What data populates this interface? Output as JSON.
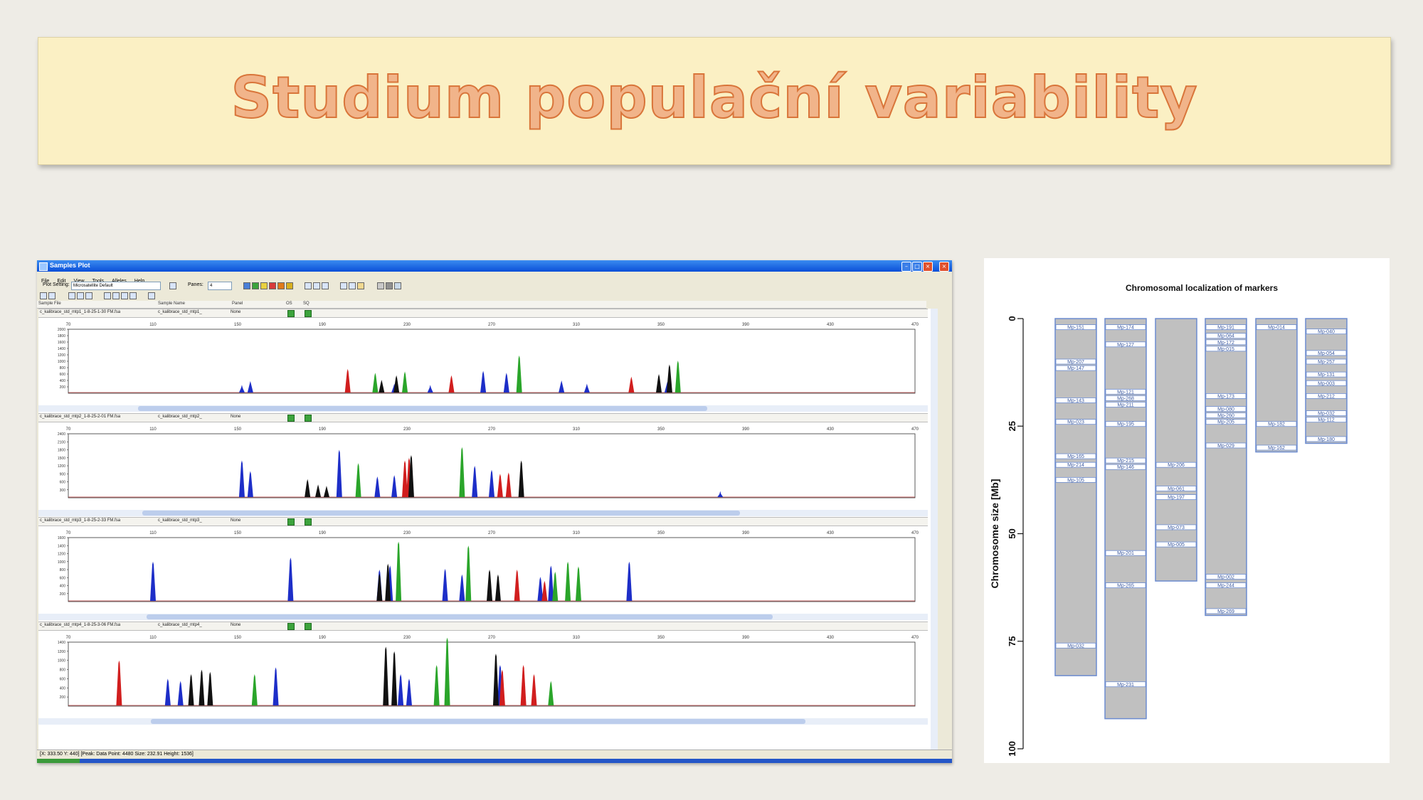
{
  "slide": {
    "title": "Studium populační variability"
  },
  "window": {
    "title": "Samples Plot",
    "menu": [
      "File",
      "Edit",
      "View",
      "Tools",
      "Alleles",
      "Help"
    ],
    "toolbar": {
      "plot_setting_label": "Plot Setting:",
      "plot_setting_value": "Microsatellite Default",
      "panes_label": "Panes:",
      "panes_value": "4"
    },
    "columns": [
      "Sample File",
      "Sample Name",
      "Panel",
      "OS",
      "SQ"
    ],
    "status": "[X: 333.50  Y: 440]  [Peak: Data Point: 4480  Size: 232.91  Height: 1536]",
    "panes": [
      {
        "file": "c_kalibrace_std_mtp1_1-8-25-1-30 FM.fsa",
        "name": "c_kalibrace_std_mtp1_",
        "panel": "None",
        "x_ticks": [
          "70",
          "110",
          "150",
          "190",
          "230",
          "270",
          "310",
          "350",
          "390",
          "430",
          "470"
        ],
        "y_ticks": [
          "2000",
          "1800",
          "1600",
          "1400",
          "1200",
          "1000",
          "800",
          "600",
          "400",
          "200"
        ]
      },
      {
        "file": "c_kalibrace_std_mtp2_1-8-25-2-01 FM.fsa",
        "name": "c_kalibrace_std_mtp2_",
        "panel": "None",
        "x_ticks": [
          "70",
          "110",
          "150",
          "190",
          "230",
          "270",
          "310",
          "350",
          "390",
          "430",
          "470"
        ],
        "y_ticks": [
          "2400",
          "2100",
          "1800",
          "1500",
          "1200",
          "900",
          "600",
          "300"
        ]
      },
      {
        "file": "c_kalibrace_std_mtp3_1-8-25-2-33 FM.fsa",
        "name": "c_kalibrace_std_mtp3_",
        "panel": "None",
        "x_ticks": [
          "70",
          "110",
          "150",
          "190",
          "230",
          "270",
          "310",
          "350",
          "390",
          "430",
          "470"
        ],
        "y_ticks": [
          "1600",
          "1400",
          "1200",
          "1000",
          "800",
          "600",
          "400",
          "200"
        ]
      },
      {
        "file": "c_kalibrace_std_mtp4_1-8-25-3-06 FM.fsa",
        "name": "c_kalibrace_std_mtp4_",
        "panel": "None",
        "x_ticks": [
          "70",
          "110",
          "150",
          "190",
          "230",
          "270",
          "310",
          "350",
          "390",
          "430",
          "470"
        ],
        "y_ticks": [
          "1400",
          "1200",
          "1000",
          "800",
          "600",
          "400",
          "200"
        ]
      }
    ]
  },
  "chart_data": [
    {
      "type": "line",
      "title": "",
      "xlim": [
        70,
        470
      ],
      "series": [
        {
          "color": "#1d2ec8",
          "points": [
            [
              152,
              260
            ],
            [
              156,
              380
            ],
            [
              224,
              300
            ],
            [
              241,
              260
            ],
            [
              266,
              700
            ],
            [
              277,
              640
            ],
            [
              303,
              400
            ],
            [
              315,
              300
            ],
            [
              353,
              360
            ]
          ]
        },
        {
          "color": "#d11e1e",
          "points": [
            [
              202,
              760
            ],
            [
              251,
              560
            ],
            [
              336,
              520
            ]
          ]
        },
        {
          "color": "#111111",
          "points": [
            [
              218,
              420
            ],
            [
              225,
              560
            ],
            [
              349,
              600
            ],
            [
              354,
              900
            ]
          ]
        },
        {
          "color": "#2aa52a",
          "points": [
            [
              215,
              640
            ],
            [
              229,
              680
            ],
            [
              283,
              1180
            ],
            [
              358,
              1020
            ]
          ]
        }
      ]
    },
    {
      "type": "line",
      "title": "",
      "xlim": [
        70,
        470
      ],
      "series": [
        {
          "color": "#1d2ec8",
          "points": [
            [
              152,
              1400
            ],
            [
              156,
              1000
            ],
            [
              198,
              1800
            ],
            [
              216,
              800
            ],
            [
              224,
              850
            ],
            [
              262,
              1200
            ],
            [
              270,
              1050
            ],
            [
              378,
              250
            ]
          ]
        },
        {
          "color": "#d11e1e",
          "points": [
            [
              229,
              1400
            ],
            [
              231,
              1500
            ],
            [
              274,
              900
            ],
            [
              278,
              950
            ]
          ]
        },
        {
          "color": "#111111",
          "points": [
            [
              183,
              700
            ],
            [
              188,
              500
            ],
            [
              192,
              450
            ],
            [
              232,
              1600
            ],
            [
              284,
              1400
            ]
          ]
        },
        {
          "color": "#2aa52a",
          "points": [
            [
              207,
              1300
            ],
            [
              256,
              1900
            ]
          ]
        }
      ]
    },
    {
      "type": "line",
      "title": "",
      "xlim": [
        70,
        470
      ],
      "series": [
        {
          "color": "#1d2ec8",
          "points": [
            [
              110,
              1000
            ],
            [
              175,
              1100
            ],
            [
              217,
              800
            ],
            [
              222,
              900
            ],
            [
              248,
              820
            ],
            [
              256,
              680
            ],
            [
              293,
              620
            ],
            [
              298,
              900
            ],
            [
              335,
              1000
            ]
          ]
        },
        {
          "color": "#d11e1e",
          "points": [
            [
              282,
              800
            ],
            [
              295,
              520
            ]
          ]
        },
        {
          "color": "#111111",
          "points": [
            [
              217,
              700
            ],
            [
              221,
              950
            ],
            [
              269,
              800
            ],
            [
              273,
              680
            ]
          ]
        },
        {
          "color": "#2aa52a",
          "points": [
            [
              226,
              1500
            ],
            [
              259,
              1400
            ],
            [
              300,
              750
            ],
            [
              306,
              1000
            ],
            [
              311,
              880
            ]
          ]
        }
      ]
    },
    {
      "type": "line",
      "title": "",
      "xlim": [
        70,
        470
      ],
      "series": [
        {
          "color": "#1d2ec8",
          "points": [
            [
              117,
              600
            ],
            [
              123,
              550
            ],
            [
              168,
              850
            ],
            [
              227,
              700
            ],
            [
              231,
              600
            ],
            [
              274,
              900
            ]
          ]
        },
        {
          "color": "#d11e1e",
          "points": [
            [
              94,
              1000
            ],
            [
              275,
              800
            ],
            [
              285,
              900
            ],
            [
              290,
              700
            ]
          ]
        },
        {
          "color": "#111111",
          "points": [
            [
              128,
              700
            ],
            [
              133,
              800
            ],
            [
              137,
              750
            ],
            [
              220,
              1300
            ],
            [
              224,
              1200
            ],
            [
              272,
              1150
            ]
          ]
        },
        {
          "color": "#2aa52a",
          "points": [
            [
              158,
              700
            ],
            [
              244,
              900
            ],
            [
              249,
              1500
            ],
            [
              298,
              550
            ]
          ]
        }
      ]
    },
    {
      "type": "bar",
      "title": "Chromosomal localization of markers",
      "ylabel": "Chromosome size [Mb]",
      "ylim": [
        0,
        100
      ],
      "y_ticks": [
        "0",
        "25",
        "50",
        "75",
        "100"
      ],
      "chromosomes": [
        {
          "length": 83,
          "markers": [
            {
              "label": "Mp-151",
              "pos": 2
            },
            {
              "label": "Mp-207",
              "pos": 10
            },
            {
              "label": "Mp-147",
              "pos": 11.5
            },
            {
              "label": "Mp-143",
              "pos": 19
            },
            {
              "label": "Mp-023",
              "pos": 24
            },
            {
              "label": "Mp-165",
              "pos": 32
            },
            {
              "label": "Mp-214",
              "pos": 34
            },
            {
              "label": "Mp-105",
              "pos": 37.5
            },
            {
              "label": "Mp-032",
              "pos": 76
            }
          ]
        },
        {
          "length": 93,
          "markers": [
            {
              "label": "Mp-174",
              "pos": 2
            },
            {
              "label": "Mp-127",
              "pos": 6
            },
            {
              "label": "Mp-121",
              "pos": 17
            },
            {
              "label": "Mp-268",
              "pos": 18.5
            },
            {
              "label": "Mp-211",
              "pos": 20
            },
            {
              "label": "Mp-195",
              "pos": 24.5
            },
            {
              "label": "Mp-215",
              "pos": 33
            },
            {
              "label": "Mp-146",
              "pos": 34.5
            },
            {
              "label": "Mp-201",
              "pos": 54.5
            },
            {
              "label": "Mp-265",
              "pos": 62
            },
            {
              "label": "Mp-231",
              "pos": 85
            }
          ]
        },
        {
          "length": 61,
          "markers": [
            {
              "label": "Mp-206",
              "pos": 34
            },
            {
              "label": "Mp-061",
              "pos": 39.5
            },
            {
              "label": "Mp-197",
              "pos": 41.5
            },
            {
              "label": "Mp-073",
              "pos": 48.5
            },
            {
              "label": "Mp-005",
              "pos": 52.5
            }
          ]
        },
        {
          "length": 69,
          "markers": [
            {
              "label": "Mp-191",
              "pos": 2
            },
            {
              "label": "Mp-064",
              "pos": 4
            },
            {
              "label": "Mp-172",
              "pos": 5.5
            },
            {
              "label": "Mp-015",
              "pos": 7
            },
            {
              "label": "Mp-173",
              "pos": 18
            },
            {
              "label": "Mp-080",
              "pos": 21
            },
            {
              "label": "Mp-260",
              "pos": 22.5
            },
            {
              "label": "Mp-205",
              "pos": 24
            },
            {
              "label": "Mp-029",
              "pos": 29.5
            },
            {
              "label": "Mp-002",
              "pos": 60
            },
            {
              "label": "Mp-244",
              "pos": 62
            },
            {
              "label": "Mp-269",
              "pos": 68
            }
          ]
        },
        {
          "length": 31,
          "markers": [
            {
              "label": "Mp-014",
              "pos": 2
            },
            {
              "label": "Mp-182",
              "pos": 24.5
            },
            {
              "label": "Mp-162",
              "pos": 30
            }
          ]
        },
        {
          "length": 29,
          "markers": [
            {
              "label": "Mp-040",
              "pos": 3
            },
            {
              "label": "Mp-054",
              "pos": 8
            },
            {
              "label": "Mp-257",
              "pos": 10
            },
            {
              "label": "Mp-131",
              "pos": 13
            },
            {
              "label": "Mp-003",
              "pos": 15
            },
            {
              "label": "Mp-212",
              "pos": 18
            },
            {
              "label": "Mp-032",
              "pos": 22
            },
            {
              "label": "Mp-112",
              "pos": 23.5
            },
            {
              "label": "Mp-180",
              "pos": 28
            }
          ]
        }
      ]
    }
  ]
}
